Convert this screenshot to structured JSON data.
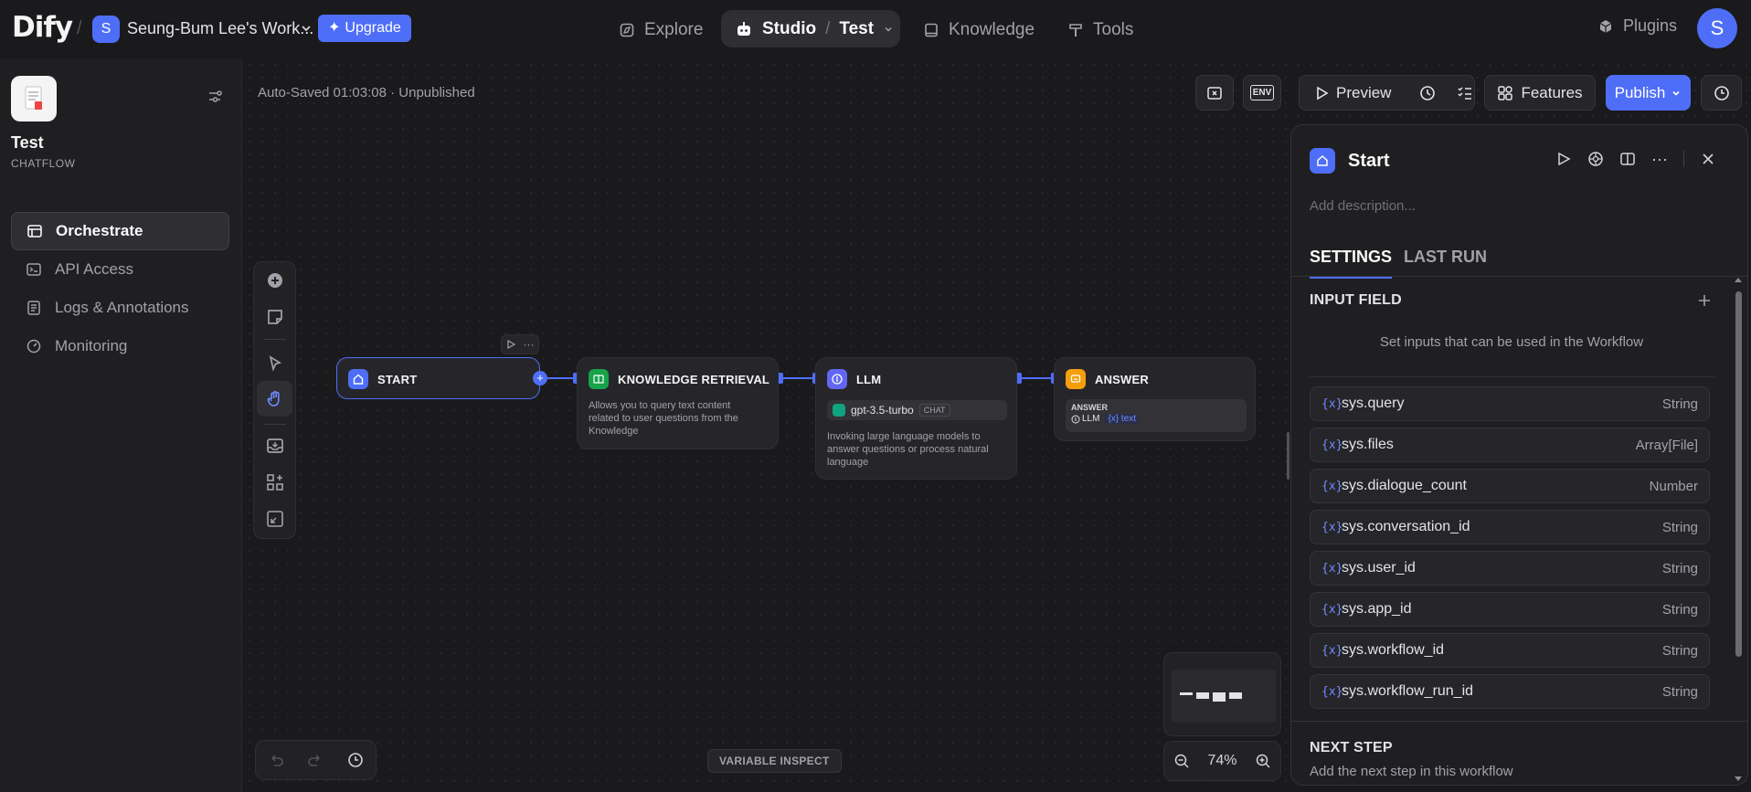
{
  "topbar": {
    "logo": "Dify",
    "workspace": {
      "initial": "S",
      "name": "Seung-Bum Lee's Work..."
    },
    "upgrade_label": "Upgrade",
    "nav": {
      "explore": "Explore",
      "studio": "Studio",
      "app_name": "Test",
      "knowledge": "Knowledge",
      "tools": "Tools"
    },
    "plugins_label": "Plugins",
    "user_initial": "S"
  },
  "sidebar": {
    "app_title": "Test",
    "app_type": "CHATFLOW",
    "items": [
      {
        "label": "Orchestrate",
        "icon": "window-icon",
        "active": true
      },
      {
        "label": "API Access",
        "icon": "terminal-icon",
        "active": false
      },
      {
        "label": "Logs & Annotations",
        "icon": "list-icon",
        "active": false
      },
      {
        "label": "Monitoring",
        "icon": "gauge-icon",
        "active": false
      }
    ]
  },
  "toolbar": {
    "autosave_text": "Auto-Saved 01:03:08 · Unpublished",
    "env_label": "ENV",
    "preview_label": "Preview",
    "features_label": "Features",
    "publish_label": "Publish"
  },
  "nodes": {
    "start": {
      "title": "START"
    },
    "knowledge": {
      "title": "KNOWLEDGE RETRIEVAL",
      "desc_lines": [
        "Allows you to query text content",
        "related to user questions from the",
        "Knowledge"
      ]
    },
    "llm": {
      "title": "LLM",
      "model": "gpt-3.5-turbo",
      "model_tag": "CHAT",
      "desc_lines": [
        "Invoking large language models to",
        "answer questions or process natural",
        "language"
      ]
    },
    "answer": {
      "title": "ANSWER",
      "field_label": "ANSWER",
      "ref_node": "LLM",
      "ref_var": "text"
    }
  },
  "bottom": {
    "variable_inspect": "VARIABLE INSPECT",
    "zoom": "74%"
  },
  "panel": {
    "title": "Start",
    "description_placeholder": "Add description...",
    "tabs": {
      "settings": "SETTINGS",
      "last_run": "LAST RUN"
    },
    "input_field_title": "INPUT FIELD",
    "input_hint": "Set inputs that can be used in the Workflow",
    "variables": [
      {
        "name": "sys.query",
        "type": "String"
      },
      {
        "name": "sys.files",
        "type": "Array[File]"
      },
      {
        "name": "sys.dialogue_count",
        "type": "Number"
      },
      {
        "name": "sys.conversation_id",
        "type": "String"
      },
      {
        "name": "sys.user_id",
        "type": "String"
      },
      {
        "name": "sys.app_id",
        "type": "String"
      },
      {
        "name": "sys.workflow_id",
        "type": "String"
      },
      {
        "name": "sys.workflow_run_id",
        "type": "String"
      }
    ],
    "next_step_title": "NEXT STEP",
    "next_step_hint": "Add the next step in this workflow"
  },
  "colors": {
    "accent": "#4f6ef7",
    "knowledge_node": "#16a34a",
    "answer_node": "#f59e0b",
    "background": "#1a1a1c"
  }
}
